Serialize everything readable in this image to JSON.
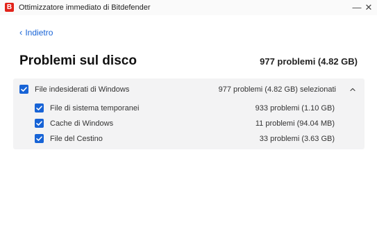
{
  "window": {
    "logo_letter": "B",
    "title": "Ottimizzatore immediato di Bitdefender",
    "minimize_glyph": "—",
    "close_glyph": "✕"
  },
  "nav": {
    "back_label": "Indietro"
  },
  "header": {
    "title": "Problemi sul disco",
    "summary": "977 problemi (4.82 GB)"
  },
  "group": {
    "label": "File indesiderati di Windows",
    "count": "977 problemi (4.82 GB) selezionati",
    "checked": true,
    "expanded": true,
    "items": [
      {
        "label": "File di sistema temporanei",
        "count": "933 problemi (1.10 GB)",
        "checked": true
      },
      {
        "label": "Cache di Windows",
        "count": "11 problemi (94.04 MB)",
        "checked": true
      },
      {
        "label": "File del Cestino",
        "count": "33 problemi (3.63 GB)",
        "checked": true
      }
    ]
  },
  "colors": {
    "accent": "#1763d6",
    "brand": "#e2231a",
    "panel_bg": "#f3f3f4"
  }
}
